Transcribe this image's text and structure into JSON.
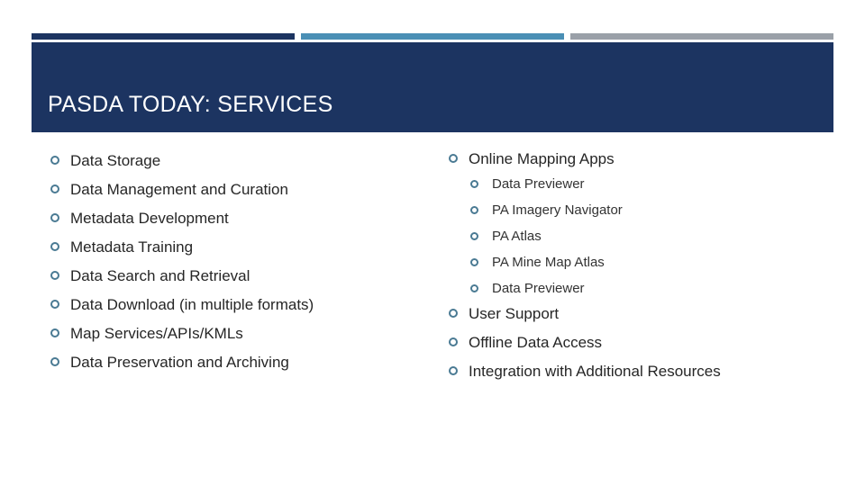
{
  "slide": {
    "title": "PASDA TODAY: SERVICES",
    "accent_colors": {
      "navy": "#1c3461",
      "blue": "#4a8fb5",
      "gray": "#9aa0a8",
      "bullet": "#4a7a93"
    },
    "left_column": [
      "Data Storage",
      "Data Management and Curation",
      "Metadata Development",
      "Metadata Training",
      "Data Search and Retrieval",
      "Data Download (in multiple formats)",
      "Map Services/APIs/KMLs",
      "Data Preservation and Archiving"
    ],
    "right_column": {
      "online_mapping": {
        "label": "Online Mapping Apps",
        "sub_items": [
          "Data Previewer",
          "PA Imagery Navigator",
          "PA Atlas",
          "PA Mine Map Atlas",
          "Data Previewer"
        ]
      },
      "items": [
        "User Support",
        "Offline Data Access",
        "Integration with Additional Resources"
      ]
    }
  }
}
